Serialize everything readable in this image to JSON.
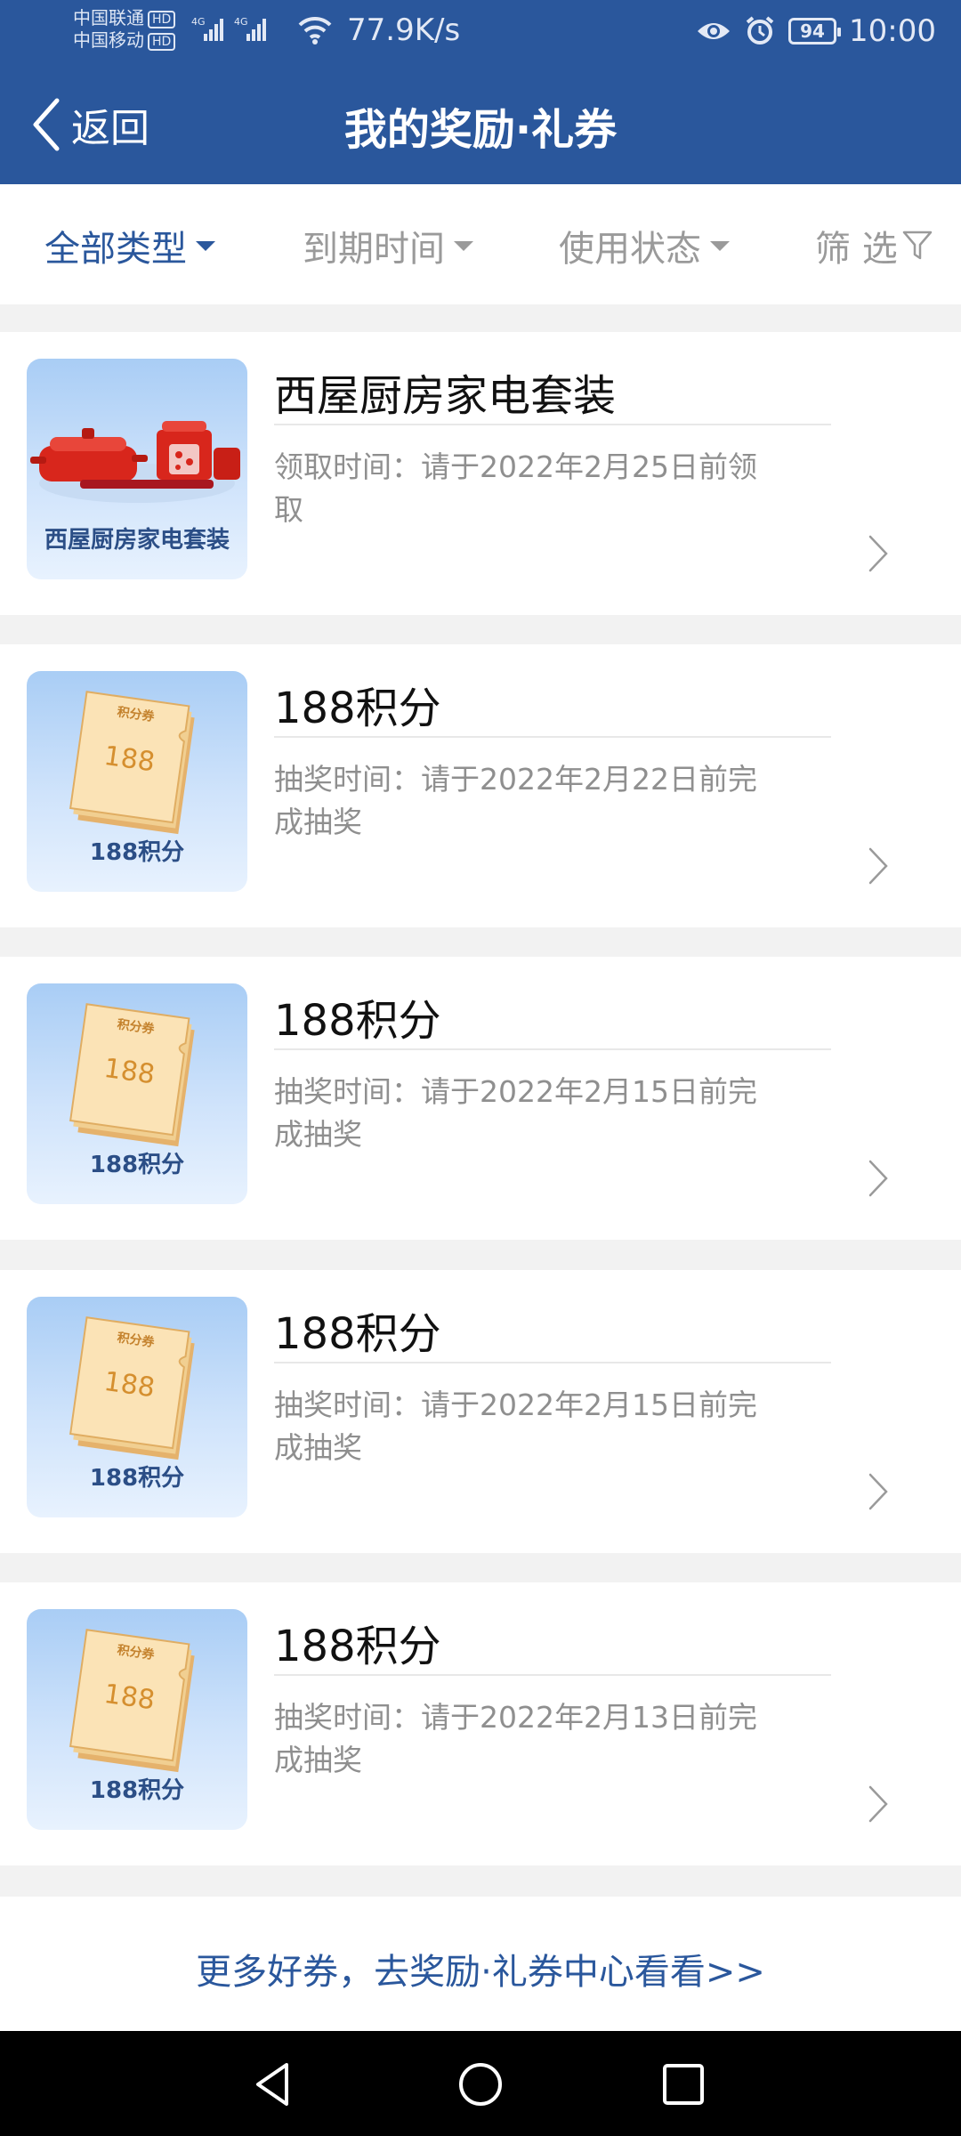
{
  "status_bar": {
    "carrier1": "中国联通",
    "carrier2": "中国移动",
    "hd": "HD",
    "speed": "77.9K/s",
    "battery": "94",
    "time": "10:00"
  },
  "nav": {
    "back_label": "返回",
    "title": "我的奖励·礼券"
  },
  "filters": [
    {
      "label": "全部类型",
      "active": true
    },
    {
      "label": "到期时间",
      "active": false
    },
    {
      "label": "使用状态",
      "active": false
    },
    {
      "label": "筛 选",
      "active": false
    }
  ],
  "rewards": [
    {
      "title": "西屋厨房家电套装",
      "thumb_caption": "西屋厨房家电套装",
      "desc": "领取时间：请于2022年2月25日前领取",
      "kind": "appliance"
    },
    {
      "title": "188积分",
      "thumb_caption": "188积分",
      "coupon_label": "积分券",
      "coupon_value": "188",
      "desc": "抽奖时间：请于2022年2月22日前完成抽奖",
      "kind": "points"
    },
    {
      "title": "188积分",
      "thumb_caption": "188积分",
      "coupon_label": "积分券",
      "coupon_value": "188",
      "desc": "抽奖时间：请于2022年2月15日前完成抽奖",
      "kind": "points"
    },
    {
      "title": "188积分",
      "thumb_caption": "188积分",
      "coupon_label": "积分券",
      "coupon_value": "188",
      "desc": "抽奖时间：请于2022年2月15日前完成抽奖",
      "kind": "points"
    },
    {
      "title": "188积分",
      "thumb_caption": "188积分",
      "coupon_label": "积分券",
      "coupon_value": "188",
      "desc": "抽奖时间：请于2022年2月13日前完成抽奖",
      "kind": "points"
    }
  ],
  "footer_link": "更多好券，去奖励·礼券中心看看>>",
  "colors": {
    "brand": "#2a579c",
    "muted_text": "#8f8f8f",
    "page_bg": "#f2f2f2"
  }
}
